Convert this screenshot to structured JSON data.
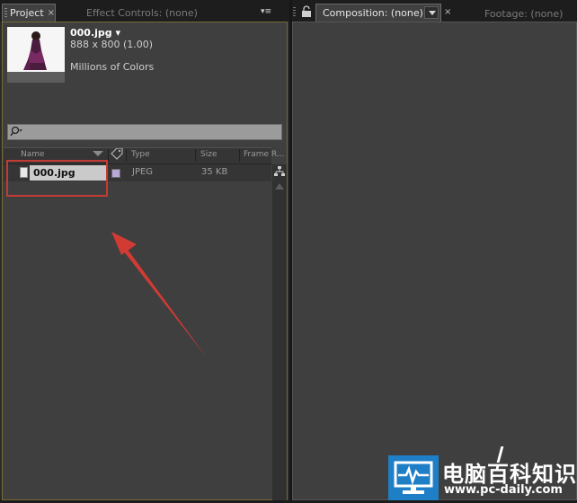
{
  "project_panel": {
    "tab_label": "Project",
    "tab_close": "×",
    "effect_tab_label": "Effect Controls: (none)",
    "panel_menu": "▾≡",
    "file_info": {
      "name": "000.jpg ▾",
      "dimensions": "888 x 800 (1.00)",
      "color_depth": "Millions of Colors"
    },
    "search": {
      "placeholder": ""
    },
    "columns": [
      "Name",
      "Type",
      "Size",
      "Frame R..."
    ],
    "items": [
      {
        "name": "000.jpg",
        "type": "JPEG",
        "size": "35 KB",
        "label_color": "#b9a8d8"
      }
    ]
  },
  "composition_panel": {
    "tab_label": "Composition: (none)",
    "tab_close": "×",
    "footage_tab_label": "Footage: (none)"
  },
  "annotation": {
    "highlight_color": "#c33b35"
  },
  "watermark": {
    "site_name_cn": "电脑百科知识",
    "url": "www.pc-daily.com",
    "logo_color": "#1e7fc6"
  },
  "colors": {
    "panel_bg": "#3f3f3f",
    "tabbar_bg": "#1d1d1d",
    "active_border": "#7a6a34"
  }
}
